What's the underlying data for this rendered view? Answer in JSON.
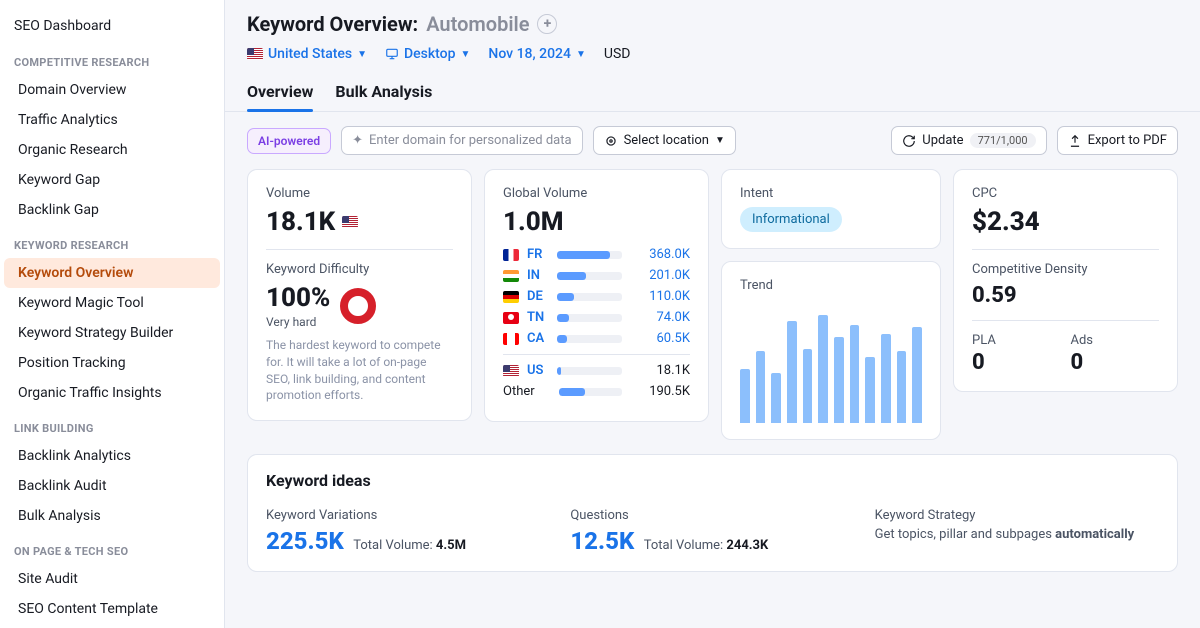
{
  "sidebar": {
    "title": "SEO Dashboard",
    "groups": [
      {
        "header": "COMPETITIVE RESEARCH",
        "items": [
          "Domain Overview",
          "Traffic Analytics",
          "Organic Research",
          "Keyword Gap",
          "Backlink Gap"
        ]
      },
      {
        "header": "KEYWORD RESEARCH",
        "items": [
          "Keyword Overview",
          "Keyword Magic Tool",
          "Keyword Strategy Builder",
          "Position Tracking",
          "Organic Traffic Insights"
        ],
        "active": 0
      },
      {
        "header": "LINK BUILDING",
        "items": [
          "Backlink Analytics",
          "Backlink Audit",
          "Bulk Analysis"
        ]
      },
      {
        "header": "ON PAGE & TECH SEO",
        "items": [
          "Site Audit",
          "SEO Content Template"
        ]
      }
    ]
  },
  "header": {
    "title_prefix": "Keyword Overview:",
    "keyword": "Automobile",
    "country": "United States",
    "device": "Desktop",
    "date": "Nov 18, 2024",
    "currency": "USD"
  },
  "tabs": [
    "Overview",
    "Bulk Analysis"
  ],
  "toolbar": {
    "ai_badge": "AI-powered",
    "domain_placeholder": "Enter domain for personalized data",
    "location_label": "Select location",
    "update_label": "Update",
    "update_count": "771/1,000",
    "export_label": "Export to PDF"
  },
  "metrics": {
    "volume": {
      "label": "Volume",
      "value": "18.1K"
    },
    "kd": {
      "label": "Keyword Difficulty",
      "value": "100%",
      "tag": "Very hard",
      "desc": "The hardest keyword to compete for. It will take a lot of on-page SEO, link building, and content promotion efforts."
    },
    "global": {
      "label": "Global Volume",
      "value": "1.0M",
      "rows": [
        {
          "cc": "FR",
          "flag": "fr",
          "val": "368.0K",
          "pct": 82
        },
        {
          "cc": "IN",
          "flag": "in",
          "val": "201.0K",
          "pct": 45
        },
        {
          "cc": "DE",
          "flag": "de",
          "val": "110.0K",
          "pct": 26
        },
        {
          "cc": "TN",
          "flag": "tn",
          "val": "74.0K",
          "pct": 18
        },
        {
          "cc": "CA",
          "flag": "ca",
          "val": "60.5K",
          "pct": 15
        },
        {
          "cc": "US",
          "flag": "us",
          "val": "18.1K",
          "pct": 6,
          "plain": true
        },
        {
          "cc": "Other",
          "flag": "",
          "val": "190.5K",
          "pct": 42,
          "plain": true
        }
      ]
    },
    "intent": {
      "label": "Intent",
      "value": "Informational"
    },
    "trend": {
      "label": "Trend",
      "bars": [
        45,
        60,
        42,
        85,
        62,
        90,
        72,
        82,
        55,
        74,
        60,
        80
      ]
    },
    "cpc": {
      "label": "CPC",
      "value": "$2.34"
    },
    "density": {
      "label": "Competitive Density",
      "value": "0.59"
    },
    "pla": {
      "label": "PLA",
      "value": "0"
    },
    "ads": {
      "label": "Ads",
      "value": "0"
    }
  },
  "ideas": {
    "heading": "Keyword ideas",
    "variations": {
      "label": "Keyword Variations",
      "count": "225.5K",
      "tv_label": "Total Volume:",
      "tv": "4.5M"
    },
    "questions": {
      "label": "Questions",
      "count": "12.5K",
      "tv_label": "Total Volume:",
      "tv": "244.3K"
    },
    "strategy": {
      "label": "Keyword Strategy",
      "text_pre": "Get topics, pillar and subpages ",
      "text_bold": "automatically"
    }
  }
}
